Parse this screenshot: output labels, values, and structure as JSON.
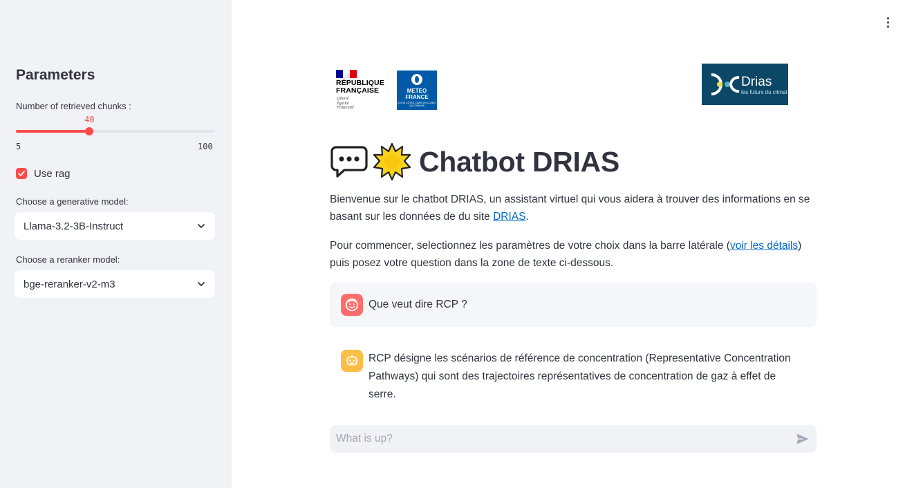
{
  "sidebar": {
    "title": "Parameters",
    "chunks": {
      "label": "Number of retrieved chunks :",
      "value": 40,
      "min": 5,
      "max": 100
    },
    "use_rag": {
      "label": "Use rag",
      "checked": true
    },
    "generative_model": {
      "label": "Choose a generative model:",
      "value": "Llama-3.2-3B-Instruct"
    },
    "reranker_model": {
      "label": "Choose a reranker model:",
      "value": "bge-reranker-v2-m3"
    }
  },
  "logos": {
    "rf": {
      "lines": [
        "RÉPUBLIQUE",
        "FRANÇAISE"
      ],
      "motto": [
        "Liberté",
        "Égalité",
        "Fraternité"
      ]
    },
    "meteo_france": {
      "lines": [
        "METEO",
        "FRANCE"
      ],
      "tagline": "À VOS CÔTÉS, DANS UN CLIMAT QUI CHANGE"
    },
    "drias": {
      "name": "Drias",
      "tagline": "les futurs du climat"
    }
  },
  "main": {
    "title": "Chatbot DRIAS",
    "intro": {
      "text_before": "Bienvenue sur le chatbot DRIAS, un assistant virtuel qui vous aidera à trouver des informations en se basant sur les données de du site ",
      "link": "DRIAS",
      "text_after": "."
    },
    "instructions": {
      "text_before": "Pour commencer, selectionnez les paramètres de votre choix dans la barre latérale (",
      "link": "voir les détails",
      "text_after": ") puis posez votre question dans la zone de texte ci-dessous."
    },
    "messages": [
      {
        "role": "user",
        "text": "Que veut dire RCP ?"
      },
      {
        "role": "assistant",
        "text": "RCP désigne les scénarios de référence de concentration (Representative Concentration Pathways) qui sont des trajectoires représentatives de concentration de gaz à effet de serre."
      }
    ],
    "chat_input": {
      "placeholder": "What is up?"
    }
  },
  "colors": {
    "accent": "#ff4b4b",
    "sidebar_bg": "#f0f2f6",
    "link": "#0068c9",
    "user_avatar": "#ff6c6c",
    "bot_avatar": "#ffbd45"
  }
}
